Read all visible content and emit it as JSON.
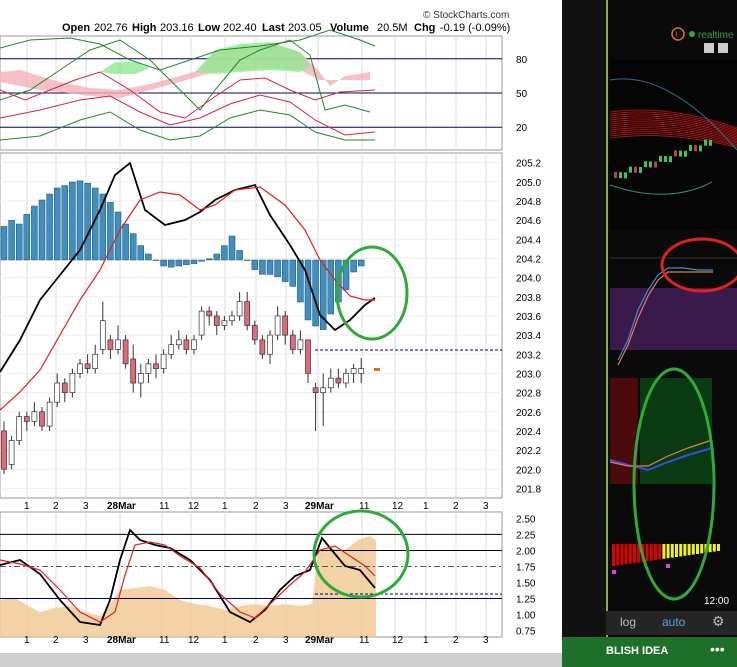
{
  "header": {
    "open_label": "Open",
    "open": "202.76",
    "high_label": "High",
    "high": "203.16",
    "low_label": "Low",
    "low": "202.40",
    "last_label": "Last",
    "last": "203.05",
    "volume_label": "Volume",
    "volume": "20.5M",
    "chg_label": "Chg",
    "chg": "-0.19 (-0.09%)",
    "brand": "© StockCharts.com"
  },
  "colors": {
    "bull": "#ffffff",
    "bear": "#e06a7a",
    "hist": "#3f8fc0",
    "fast": "#000000",
    "slow": "#e02020",
    "annot": "#2eaa3a",
    "navy": "#000066",
    "volume": "#f0c890"
  },
  "right_panel": {
    "realtime": "realtime",
    "time": "12:00",
    "log_btn": "log",
    "auto_btn": "auto",
    "gear": "⚙",
    "bottom_label": "BLISH IDEA",
    "dots": "•••"
  },
  "chart_data": [
    {
      "type": "line",
      "panel": "stochastic-top",
      "y_ticks": [
        80,
        50,
        20
      ],
      "ylim": [
        0,
        100
      ],
      "grid": true
    },
    {
      "type": "bar",
      "panel": "price",
      "y_ticks": [
        "205.2",
        "205.0",
        "204.8",
        "204.6",
        "204.4",
        "204.2",
        "204.0",
        "203.8",
        "203.6",
        "203.4",
        "203.2",
        "203.0",
        "202.8",
        "202.6",
        "202.4",
        "202.2",
        "202.0",
        "201.8"
      ],
      "ylim": [
        201.7,
        205.3
      ],
      "histogram": [
        0.28,
        0.33,
        0.3,
        0.38,
        0.45,
        0.5,
        0.55,
        0.6,
        0.62,
        0.65,
        0.66,
        0.64,
        0.6,
        0.55,
        0.48,
        0.4,
        0.3,
        0.22,
        0.12,
        0.05,
        0,
        -0.05,
        -0.06,
        -0.05,
        -0.04,
        -0.03,
        -0.01,
        0.01,
        0.05,
        0.12,
        0.2,
        0.08,
        0,
        -0.08,
        -0.12,
        -0.12,
        -0.14,
        -0.18,
        -0.22,
        -0.35,
        -0.5,
        -0.55,
        -0.58,
        -0.45,
        -0.35,
        -0.25,
        -0.1,
        -0.05
      ],
      "candles": [
        [
          202.4,
          202.0,
          202.5,
          201.95
        ],
        [
          202.05,
          202.3,
          202.35,
          202.0
        ],
        [
          202.3,
          202.55,
          202.6,
          202.25
        ],
        [
          202.55,
          202.5,
          202.6,
          202.4
        ],
        [
          202.5,
          202.6,
          202.7,
          202.45
        ],
        [
          202.6,
          202.45,
          202.65,
          202.4
        ],
        [
          202.45,
          202.7,
          202.75,
          202.4
        ],
        [
          202.7,
          202.9,
          203.0,
          202.65
        ],
        [
          202.9,
          202.8,
          202.95,
          202.7
        ],
        [
          202.8,
          203.0,
          203.05,
          202.75
        ],
        [
          203.0,
          203.1,
          203.15,
          202.95
        ],
        [
          203.1,
          203.05,
          203.2,
          203.0
        ],
        [
          203.05,
          203.2,
          203.3,
          203.0
        ],
        [
          203.25,
          203.55,
          203.75,
          203.2
        ],
        [
          203.35,
          203.25,
          203.4,
          203.15
        ],
        [
          203.25,
          203.35,
          203.5,
          203.2
        ],
        [
          203.35,
          203.1,
          203.4,
          203.05
        ],
        [
          203.15,
          202.9,
          203.3,
          202.8
        ],
        [
          202.9,
          203.0,
          203.1,
          202.75
        ],
        [
          203.0,
          203.1,
          203.15,
          202.9
        ],
        [
          203.1,
          203.05,
          203.2,
          202.95
        ],
        [
          203.05,
          203.2,
          203.25,
          203.0
        ],
        [
          203.2,
          203.3,
          203.4,
          203.15
        ],
        [
          203.3,
          203.35,
          203.45,
          203.25
        ],
        [
          203.35,
          203.25,
          203.4,
          203.2
        ],
        [
          203.25,
          203.35,
          203.4,
          203.2
        ],
        [
          203.4,
          203.65,
          203.7,
          203.35
        ],
        [
          203.65,
          203.6,
          203.7,
          203.5
        ],
        [
          203.6,
          203.5,
          203.65,
          203.4
        ],
        [
          203.5,
          203.55,
          203.6,
          203.45
        ],
        [
          203.55,
          203.6,
          203.65,
          203.5
        ],
        [
          203.6,
          203.75,
          203.85,
          203.55
        ],
        [
          203.75,
          203.5,
          203.85,
          203.45
        ],
        [
          203.5,
          203.35,
          203.55,
          203.3
        ],
        [
          203.35,
          203.2,
          203.4,
          203.15
        ],
        [
          203.2,
          203.4,
          203.45,
          203.1
        ],
        [
          203.4,
          203.6,
          203.7,
          203.35
        ],
        [
          203.6,
          203.4,
          203.65,
          203.3
        ],
        [
          203.4,
          203.25,
          203.45,
          203.2
        ],
        [
          203.25,
          203.35,
          203.45,
          203.2
        ],
        [
          203.35,
          203.0,
          203.35,
          202.9
        ],
        [
          202.85,
          202.8,
          202.9,
          202.4
        ],
        [
          202.8,
          202.85,
          203.0,
          202.45
        ],
        [
          202.85,
          202.95,
          203.05,
          202.8
        ],
        [
          202.95,
          202.9,
          203.05,
          202.85
        ],
        [
          202.9,
          203.0,
          203.05,
          202.85
        ],
        [
          203.0,
          203.05,
          203.1,
          202.9
        ],
        [
          203.0,
          203.05,
          203.16,
          202.9
        ]
      ]
    },
    {
      "type": "line",
      "panel": "lower-indicator",
      "y_ticks": [
        "2.50",
        "2.25",
        "2.00",
        "1.75",
        "1.50",
        "1.25",
        "1.00",
        "0.75"
      ],
      "ylim": [
        0.65,
        2.6
      ]
    }
  ],
  "x_axis": [
    {
      "label": "1"
    },
    {
      "label": "2"
    },
    {
      "label": "3"
    },
    {
      "label": "28Mar"
    },
    {
      "label": "11"
    },
    {
      "label": "12"
    },
    {
      "label": "1"
    },
    {
      "label": "2"
    },
    {
      "label": "3"
    },
    {
      "label": "29Mar"
    },
    {
      "label": "11"
    },
    {
      "label": "12"
    },
    {
      "label": "1"
    },
    {
      "label": "2"
    },
    {
      "label": "3"
    }
  ]
}
